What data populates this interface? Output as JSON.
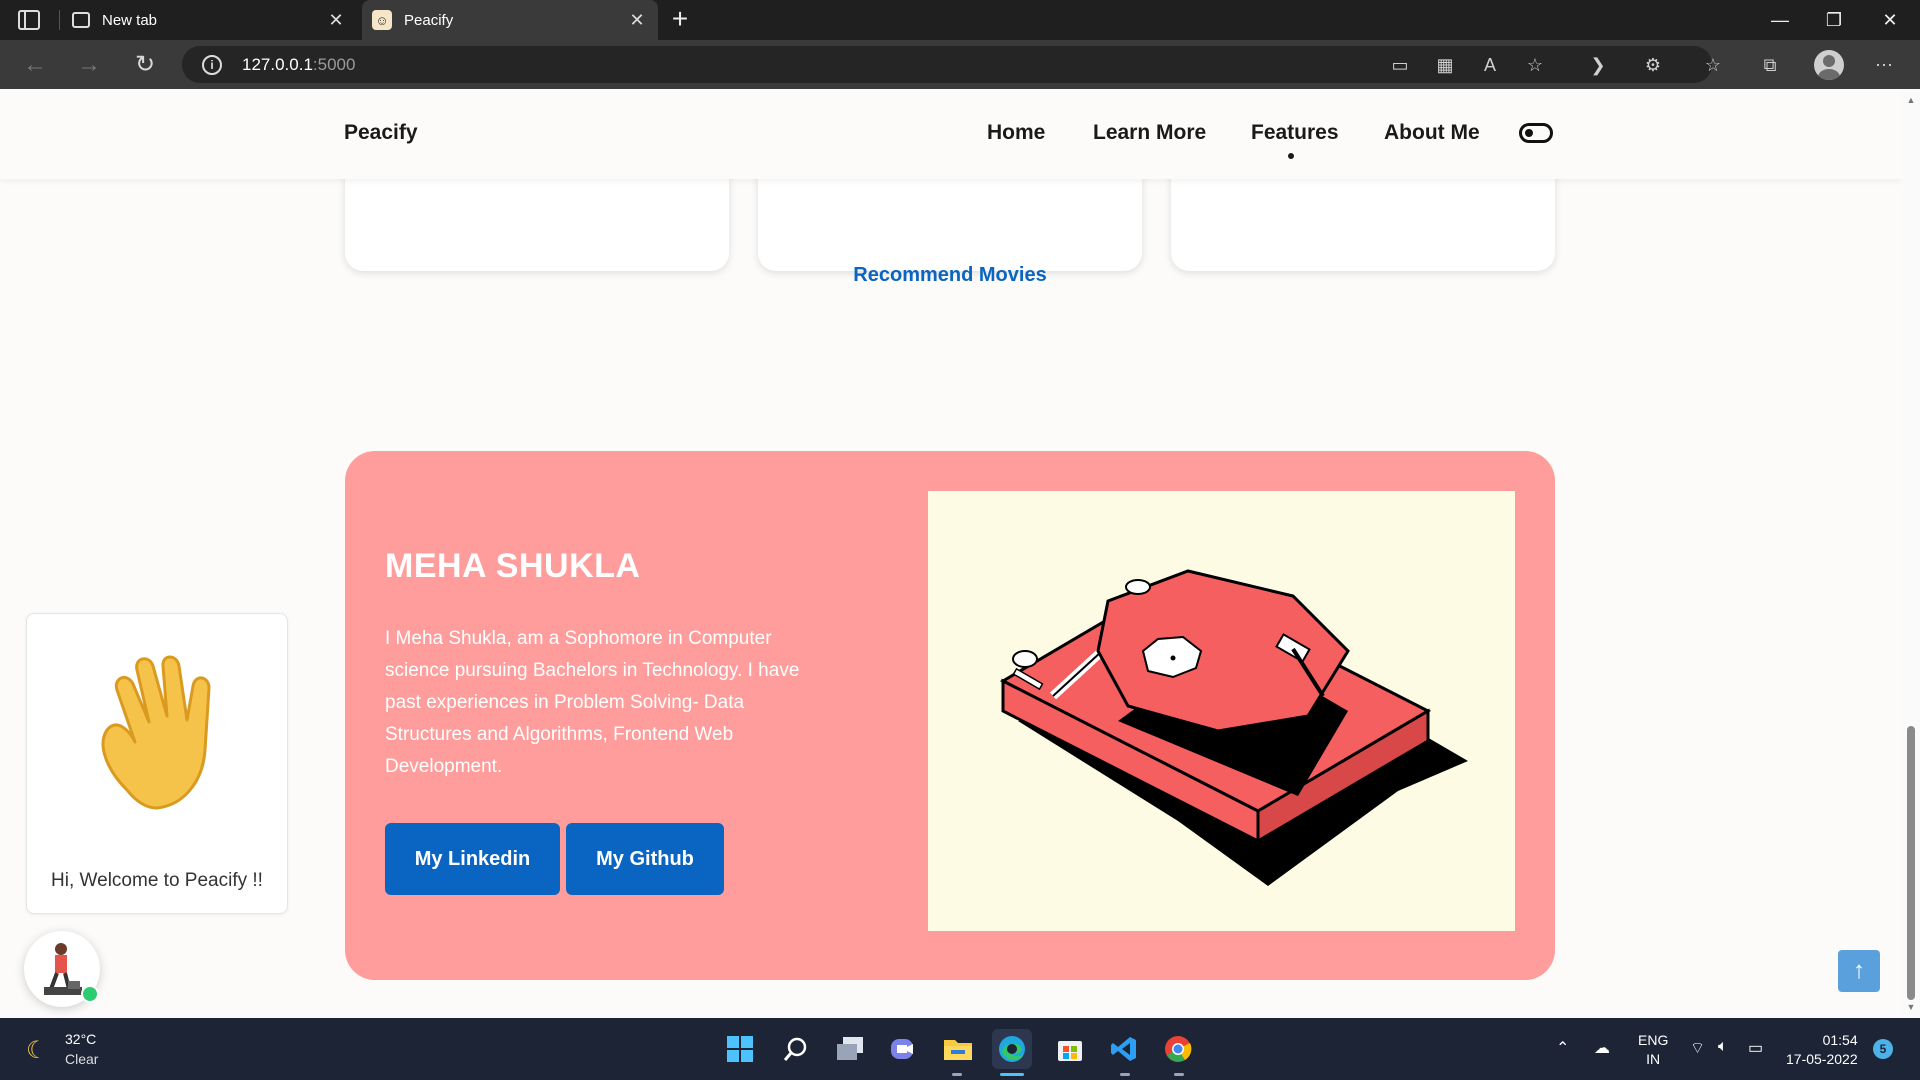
{
  "browser": {
    "tabs": [
      {
        "title": "New tab",
        "active": false
      },
      {
        "title": "Peacify",
        "active": true
      }
    ],
    "url_host": "127.0.0.1",
    "url_port": ":5000"
  },
  "site": {
    "brand": "Peacify",
    "nav": [
      {
        "label": "Home"
      },
      {
        "label": "Learn More"
      },
      {
        "label": "Features",
        "active": true
      },
      {
        "label": "About Me"
      }
    ],
    "feature_cards": [
      {
        "label": ""
      },
      {
        "label": "Recommend Movies"
      },
      {
        "label": ""
      }
    ],
    "about": {
      "name": "MEHA SHUKLA",
      "bio": "I Meha Shukla, am a Sophomore in Computer science pursuing Bachelors in Technology. I have past experiences in Problem Solving- Data Structures and Algorithms, Frontend Web Development.",
      "linkedin_label": "My Linkedin",
      "github_label": "My Github"
    },
    "welcome_text": "Hi, Welcome to Peacify !!",
    "colors": {
      "about_bg": "#fe9d9b",
      "button_blue": "#0a64c2",
      "illustration_bg": "#fefbe4",
      "turntable_red": "#f55f5f"
    }
  },
  "taskbar": {
    "weather_temp": "32°C",
    "weather_desc": "Clear",
    "lang_1": "ENG",
    "lang_2": "IN",
    "time": "01:54",
    "date": "17-05-2022",
    "notifications": "5"
  }
}
